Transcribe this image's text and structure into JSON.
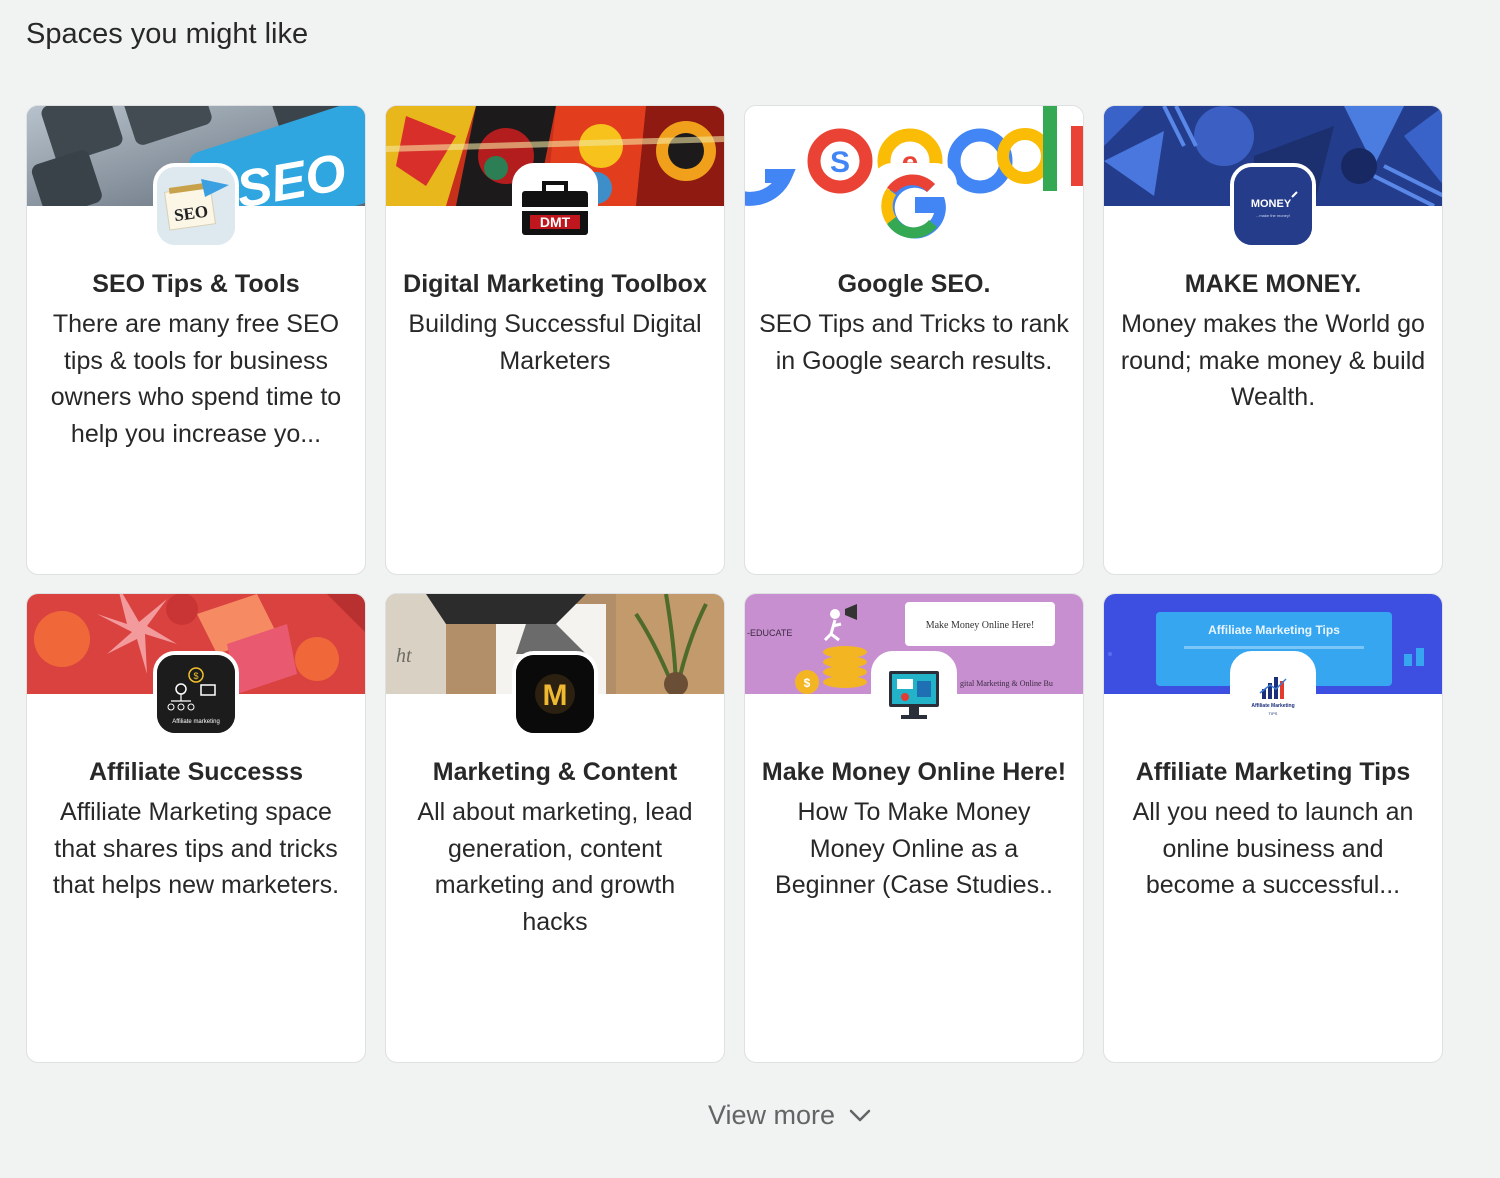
{
  "section": {
    "title": "Spaces you might like"
  },
  "spaces": [
    {
      "title": "SEO Tips & Tools",
      "description": "There are many free SEO tips & tools for business owners who spend time to help you increase yo...",
      "banner_text": "SEO",
      "avatar_text": "SEO",
      "avatar_icon": "seo-sticky-note-icon"
    },
    {
      "title": "Digital Marketing Toolbox",
      "description": "Building Successful Digital Marketers",
      "banner_text": "",
      "avatar_text": "DMT",
      "avatar_icon": "toolbox-icon"
    },
    {
      "title": "Google SEO.",
      "description": "SEO Tips and Tricks to rank in Google search results.",
      "banner_text": "Googl",
      "avatar_text": "G",
      "avatar_icon": "google-g-icon"
    },
    {
      "title": "MAKE MONEY.",
      "description": "Money makes the World go round; make money & build Wealth.",
      "banner_text": "",
      "avatar_text": "MONEY",
      "avatar_subtext": "...make the money!",
      "avatar_icon": "money-logo-icon"
    },
    {
      "title": "Affiliate Successs",
      "description": "Affiliate Marketing space that shares tips and tricks that helps new marketers.",
      "banner_text": "",
      "avatar_text": "Affiliate marketing",
      "avatar_icon": "affiliate-network-icon"
    },
    {
      "title": "Marketing & Content",
      "description": "All about marketing, lead generation, content marketing and growth hacks",
      "banner_text": "ht",
      "avatar_text": "M",
      "avatar_icon": "m-letter-icon"
    },
    {
      "title": "Make Money Online Here!",
      "description": "How To Make Money Money Online as a Beginner (Case Studies..",
      "banner_text": "Make Money Online Here!",
      "banner_left_text": "-EDUCATE",
      "banner_bottom_text": "gital Marketing & Online Bu",
      "avatar_icon": "monitor-chart-icon"
    },
    {
      "title": "Affiliate Marketing Tips",
      "description": "All you need to launch an online business and become a successful...",
      "banner_text": "Affiliate Marketing Tips",
      "avatar_text": "Affiliate Marketing",
      "avatar_subtext": "TIPS",
      "avatar_icon": "bar-chart-icon"
    }
  ],
  "footer": {
    "view_more_label": "View more"
  },
  "colors": {
    "background": "#f1f2f2",
    "card_border": "#dee0e1",
    "text": "#282829",
    "muted": "#636466"
  }
}
